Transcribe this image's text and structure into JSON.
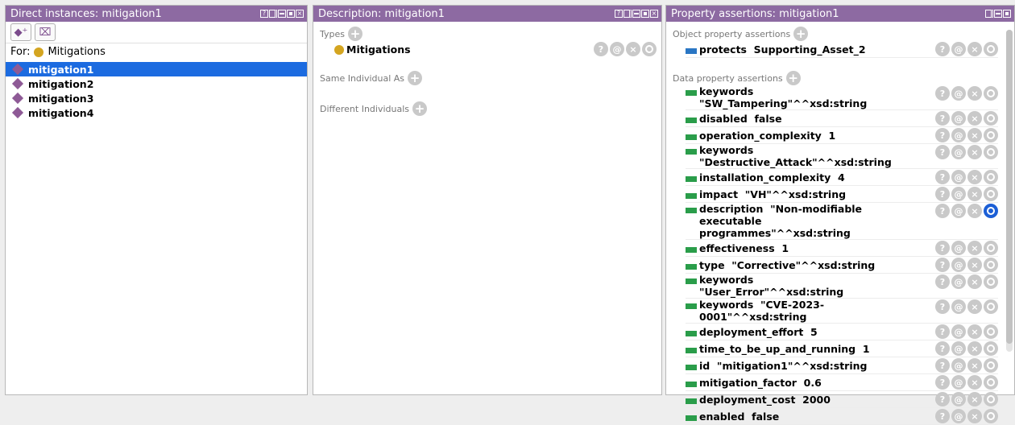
{
  "left_panel": {
    "title": "Direct instances: mitigation1",
    "for_label": "For:",
    "for_class": "Mitigations",
    "items": [
      "mitigation1",
      "mitigation2",
      "mitigation3",
      "mitigation4"
    ]
  },
  "middle_panel": {
    "title": "Description: mitigation1",
    "types_label": "Types",
    "type_value": "Mitigations",
    "same_label": "Same Individual As",
    "different_label": "Different Individuals"
  },
  "right_panel": {
    "title": "Property assertions: mitigation1",
    "object_label": "Object property assertions",
    "object_rows": [
      "protects  Supporting_Asset_2"
    ],
    "data_label": "Data property assertions",
    "data_rows": [
      "keywords  \"SW_Tampering\"^^xsd:string",
      "disabled  false",
      "operation_complexity  1",
      "keywords  \"Destructive_Attack\"^^xsd:string",
      "installation_complexity  4",
      "impact  \"VH\"^^xsd:string",
      "description  \"Non-modifiable executable programmes\"^^xsd:string",
      "effectiveness  1",
      "type  \"Corrective\"^^xsd:string",
      "keywords  \"User_Error\"^^xsd:string",
      "keywords  \"CVE-2023-0001\"^^xsd:string",
      "deployment_effort  5",
      "time_to_be_up_and_running  1",
      "id  \"mitigation1\"^^xsd:string",
      "mitigation_factor  0.6",
      "deployment_cost  2000",
      "enabled  false"
    ]
  },
  "buttons": {
    "help": "?",
    "annotate": "@",
    "delete": "×"
  },
  "colors": {
    "header": "#8d6aa2",
    "selection": "#1c6be0",
    "data_prop": "#2a9d4a",
    "object_prop": "#2a76c4",
    "class_dot": "#d4a520",
    "individual": "#8e5a96"
  },
  "icons": [
    "add-individual-icon",
    "delete-individual-icon",
    "plus-icon",
    "help-icon",
    "annotation-icon",
    "delete-icon",
    "edit-icon"
  ]
}
